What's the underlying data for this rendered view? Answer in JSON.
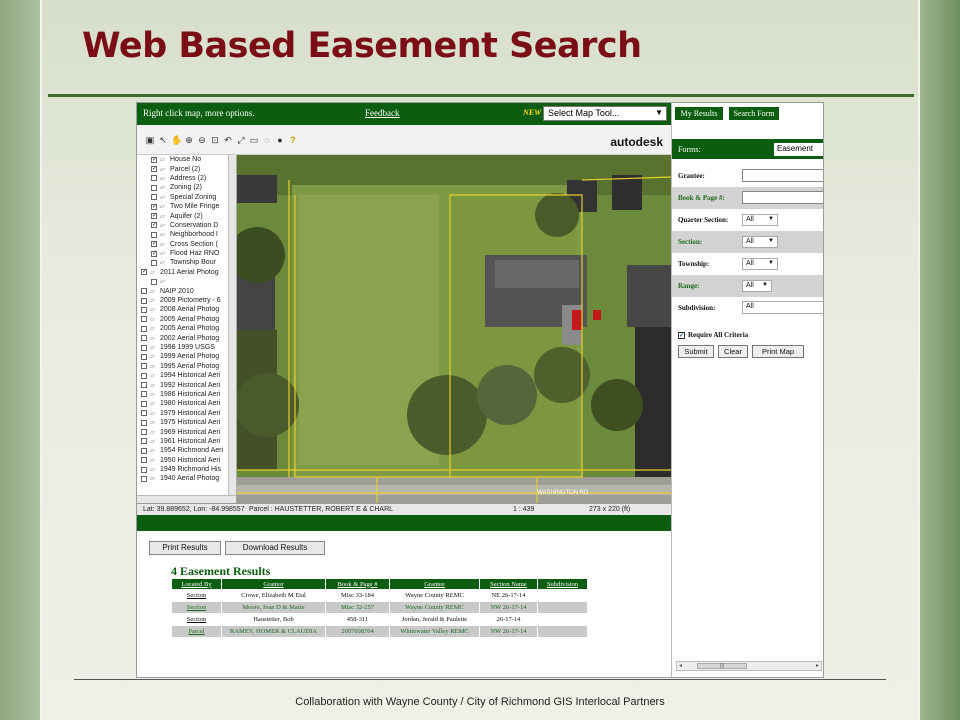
{
  "slide": {
    "title": "Web Based Easement Search",
    "footer": "Collaboration with Wayne County / City of Richmond GIS Interlocal Partners"
  },
  "topbar": {
    "hint": "Right click map, more options.",
    "feedback_link": "Feedback",
    "new_badge": "NEW",
    "map_tool_select": "Select Map Tool..."
  },
  "toolbar": {
    "brand": "autodesk"
  },
  "layers": [
    {
      "label": "House No",
      "checked": true,
      "level": "sub"
    },
    {
      "label": "Parcel (2)",
      "checked": true,
      "level": "sub"
    },
    {
      "label": "Address (2)",
      "checked": false,
      "level": "sub"
    },
    {
      "label": "Zoning (2)",
      "checked": false,
      "level": "sub"
    },
    {
      "label": "Special Zoning",
      "checked": false,
      "level": "sub"
    },
    {
      "label": "Two Mile Fringe",
      "checked": true,
      "level": "sub"
    },
    {
      "label": "Aquifer (2)",
      "checked": true,
      "level": "sub"
    },
    {
      "label": "Conservation D",
      "checked": true,
      "level": "sub"
    },
    {
      "label": "Neighborhood I",
      "checked": false,
      "level": "sub"
    },
    {
      "label": "Cross Section (",
      "checked": true,
      "level": "sub"
    },
    {
      "label": "Flood Haz RNO",
      "checked": true,
      "level": "sub"
    },
    {
      "label": "Township Bour",
      "checked": false,
      "level": "sub"
    },
    {
      "label": "2011 Aerial Photog",
      "checked": true,
      "level": "top"
    },
    {
      "label": "",
      "checked": false,
      "level": "sub"
    },
    {
      "label": "NAIP 2010",
      "checked": false,
      "level": "top"
    },
    {
      "label": "2009 Pictometry - 6",
      "checked": false,
      "level": "top"
    },
    {
      "label": "2008 Aerial Photog",
      "checked": false,
      "level": "top"
    },
    {
      "label": "2005 Aerial Photog",
      "checked": false,
      "level": "top"
    },
    {
      "label": "2005 Aerial Photog",
      "checked": false,
      "level": "top"
    },
    {
      "label": "2002 Aerial Photog",
      "checked": false,
      "level": "top"
    },
    {
      "label": "1998 1999 USGS",
      "checked": false,
      "level": "top"
    },
    {
      "label": "1999 Aerial Photog",
      "checked": false,
      "level": "top"
    },
    {
      "label": "1995 Aerial Photog",
      "checked": false,
      "level": "top"
    },
    {
      "label": "1994 Historical Aeri",
      "checked": false,
      "level": "top"
    },
    {
      "label": "1992 Historical Aeri",
      "checked": false,
      "level": "top"
    },
    {
      "label": "1986 Historical Aeri",
      "checked": false,
      "level": "top"
    },
    {
      "label": "1980 Historical Aeri",
      "checked": false,
      "level": "top"
    },
    {
      "label": "1979 Historical Aeri",
      "checked": false,
      "level": "top"
    },
    {
      "label": "1975 Historical Aeri",
      "checked": false,
      "level": "top"
    },
    {
      "label": "1969 Historical Aeri",
      "checked": false,
      "level": "top"
    },
    {
      "label": "1961 Historical Aeri",
      "checked": false,
      "level": "top"
    },
    {
      "label": "1954 Richmond Aeri",
      "checked": false,
      "level": "top"
    },
    {
      "label": "1950 Historical Aeri",
      "checked": false,
      "level": "top"
    },
    {
      "label": "1949 Richmond His",
      "checked": false,
      "level": "top"
    },
    {
      "label": "1940 Aerial Photog",
      "checked": false,
      "level": "top"
    }
  ],
  "statusbar": {
    "coords": "Lat: 39.889652, Lon: -84.998557",
    "parcel": "Parcel : HAUSTETTER, ROBERT E & CHARL",
    "scale": "1 : 439",
    "size": "273 x 220 (ft)"
  },
  "map": {
    "road_label": "WASHINGTON RD"
  },
  "results": {
    "print_button": "Print Results",
    "download_button": "Download Results",
    "title": "4 Easement Results",
    "columns": [
      "Located By",
      "Grantor",
      "Book & Page #",
      "Grantee",
      "Section Name",
      "Subdivision"
    ],
    "rows": [
      [
        "Section",
        "Crowe, Elizabeth M Etal",
        "Misc 33-184",
        "Wayne County REMC",
        "NE 26-17-14",
        ""
      ],
      [
        "Section",
        "Moore, Ivan D & Marie",
        "Misc 32-257",
        "Wayne County REMC",
        "NW 26-17-14",
        ""
      ],
      [
        "Section",
        "Haustetter, Bob",
        "458-311",
        "Jordan, Jerald & Paulette",
        "26-17-14",
        ""
      ],
      [
        "Parcel",
        "RAMEY, HOMER & CLAUDIA",
        "2007008704",
        "Whitewater Valley REMC",
        "NW 26-17-14",
        ""
      ]
    ]
  },
  "panel": {
    "tab_results": "My Results",
    "tab_search": "Search Form",
    "forms_label": "Forms:",
    "forms_value": "Easement",
    "fields": {
      "grantee": "Grantee:",
      "book_page": "Book & Page #:",
      "quarter_section": "Quarter Section:",
      "section": "Section:",
      "township": "Township:",
      "range": "Range:",
      "subdivision": "Subdivision:"
    },
    "values": {
      "quarter_section": "All",
      "section": "All",
      "township": "All",
      "range": "All",
      "subdivision": "All"
    },
    "require_all": "Require All Criteria",
    "submit": "Submit",
    "clear": "Clear",
    "print_map": "Print Map"
  },
  "colors": {
    "header_green": "#0b5e0f",
    "title_maroon": "#7a0d16",
    "parcel_line": "#e6cf2a"
  }
}
